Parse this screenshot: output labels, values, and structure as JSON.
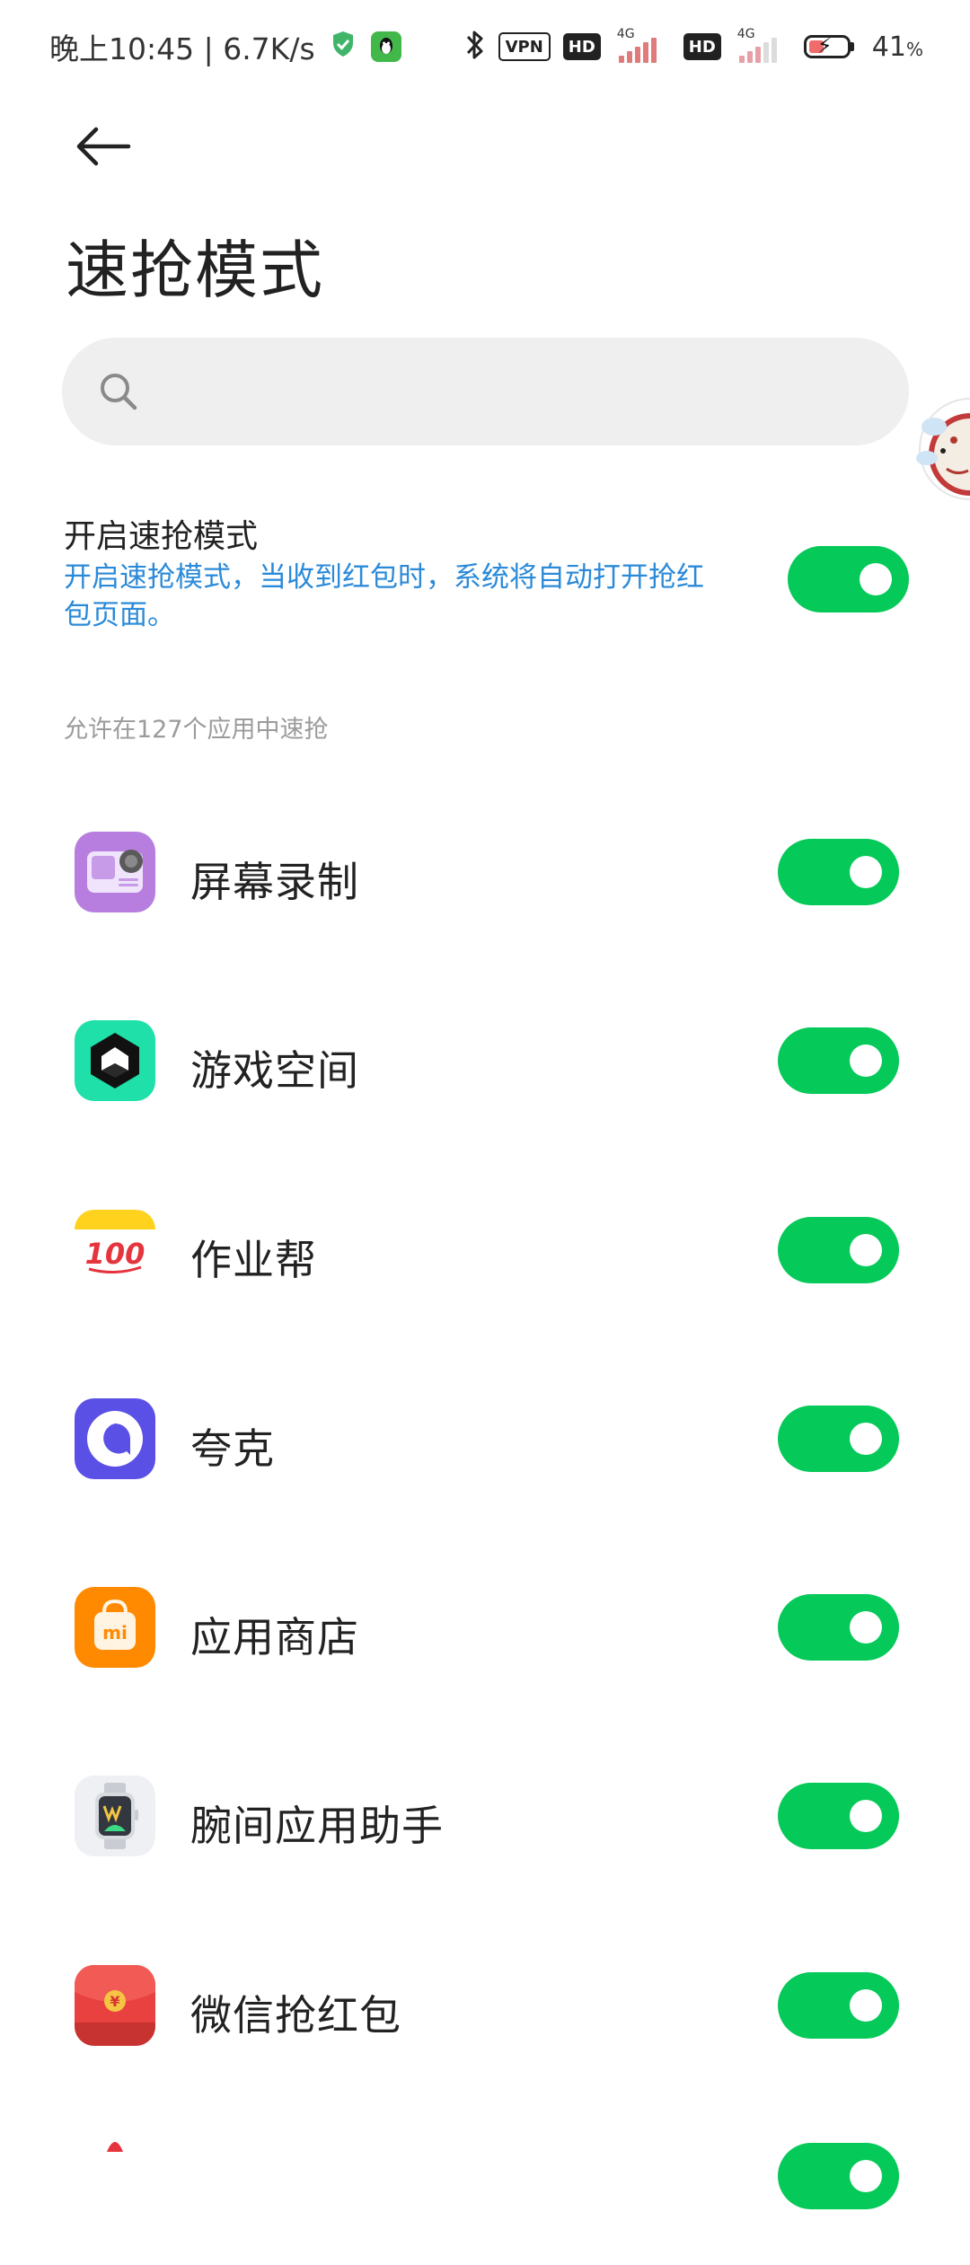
{
  "status_bar": {
    "time_speed": "晚上10:45 | 6.7K/s",
    "vpn": "VPN",
    "hd1": "HD",
    "hd2": "HD",
    "net1": "4G",
    "net2": "4G",
    "battery_level": "41",
    "battery_unit": "%",
    "battery_fraction": 0.41,
    "battery_fill_color": "#f06b6b"
  },
  "header": {
    "title": "速抢模式"
  },
  "search": {
    "placeholder": "",
    "value": ""
  },
  "master_toggle": {
    "title": "开启速抢模式",
    "description": "开启速抢模式，当收到红包时，系统将自动打开抢红包页面。",
    "on": true
  },
  "section_header": "允许在127个应用中速抢",
  "apps": [
    {
      "label": "屏幕录制",
      "icon": "screen-recorder-icon",
      "on": true
    },
    {
      "label": "游戏空间",
      "icon": "game-space-icon",
      "on": true
    },
    {
      "label": "作业帮",
      "icon": "zuoyebang-icon",
      "icon_text": "100",
      "on": true
    },
    {
      "label": "夸克",
      "icon": "quark-icon",
      "on": true
    },
    {
      "label": "应用商店",
      "icon": "app-store-icon",
      "icon_text": "mi",
      "on": true
    },
    {
      "label": "腕间应用助手",
      "icon": "watch-assistant-icon",
      "on": true
    },
    {
      "label": "微信抢红包",
      "icon": "red-envelope-icon",
      "icon_text": "¥",
      "on": true
    }
  ],
  "colors": {
    "toggle_on": "#05c958",
    "description_link": "#2b8ad8",
    "section_header": "#9b9b9b"
  }
}
